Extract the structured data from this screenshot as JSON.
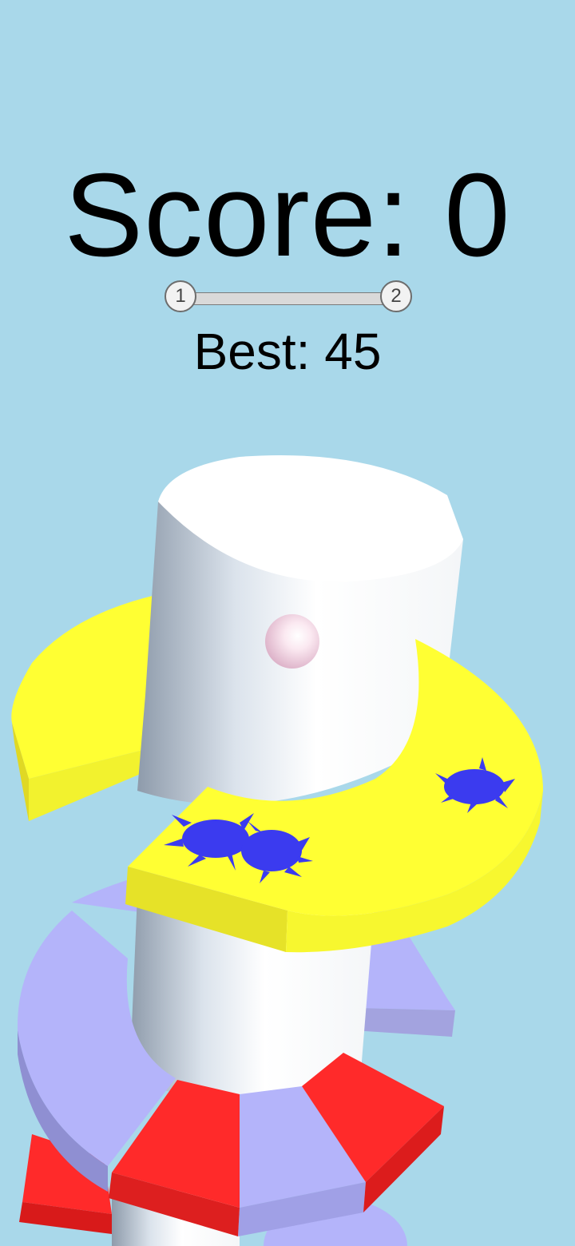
{
  "hud": {
    "score_label": "Score: 0",
    "best_label": "Best: 45",
    "level_current": "1",
    "level_next": "2",
    "level_progress": 0
  },
  "scene": {
    "background_color": "#a9d8ea",
    "tower_color": "#f2f5f8",
    "platform_safe_colors": [
      "#ffff33",
      "#b4b4fa"
    ],
    "platform_danger_color": "#ff2a2a",
    "ball_color": "#f7d9e6",
    "splat_color": "#3b3bef",
    "splat_count": 3
  }
}
